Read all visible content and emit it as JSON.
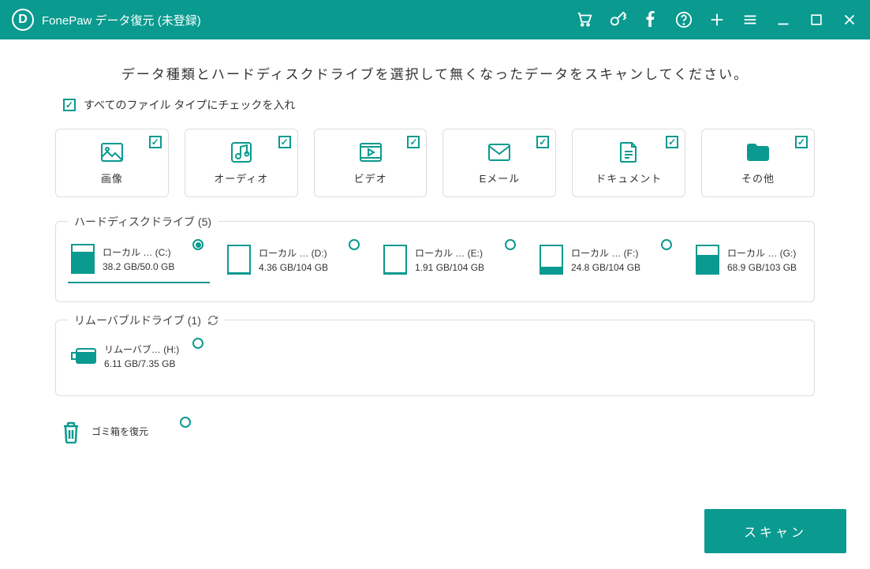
{
  "title": "FonePaw データ復元 (未登録)",
  "instruction": "データ種類とハードディスクドライブを選択して無くなったデータをスキャンしてください。",
  "check_all_label": "すべてのファイル タイプにチェックを入れ",
  "categories": [
    {
      "label": "画像"
    },
    {
      "label": "オーディオ"
    },
    {
      "label": "ビデオ"
    },
    {
      "label": "Eメール"
    },
    {
      "label": "ドキュメント"
    },
    {
      "label": "その他"
    }
  ],
  "hdd_section_title": "ハードディスクドライブ (5)",
  "removable_section_title": "リムーバブルドライブ (1)",
  "hdd": [
    {
      "name": "ローカル … (C:)",
      "size": "38.2 GB/50.0 GB",
      "fill": 76,
      "selected": true
    },
    {
      "name": "ローカル … (D:)",
      "size": "4.36 GB/104 GB",
      "fill": 4,
      "selected": false
    },
    {
      "name": "ローカル … (E:)",
      "size": "1.91 GB/104 GB",
      "fill": 2,
      "selected": false
    },
    {
      "name": "ローカル … (F:)",
      "size": "24.8 GB/104 GB",
      "fill": 24,
      "selected": false
    },
    {
      "name": "ローカル … (G:)",
      "size": "68.9 GB/103 GB",
      "fill": 67,
      "selected": false
    }
  ],
  "removable": [
    {
      "name": "リムーバブ… (H:)",
      "size": "6.11 GB/7.35 GB",
      "fill": 83,
      "selected": false
    }
  ],
  "recycle_label": "ゴミ箱を復元",
  "scan_button": "スキャン"
}
